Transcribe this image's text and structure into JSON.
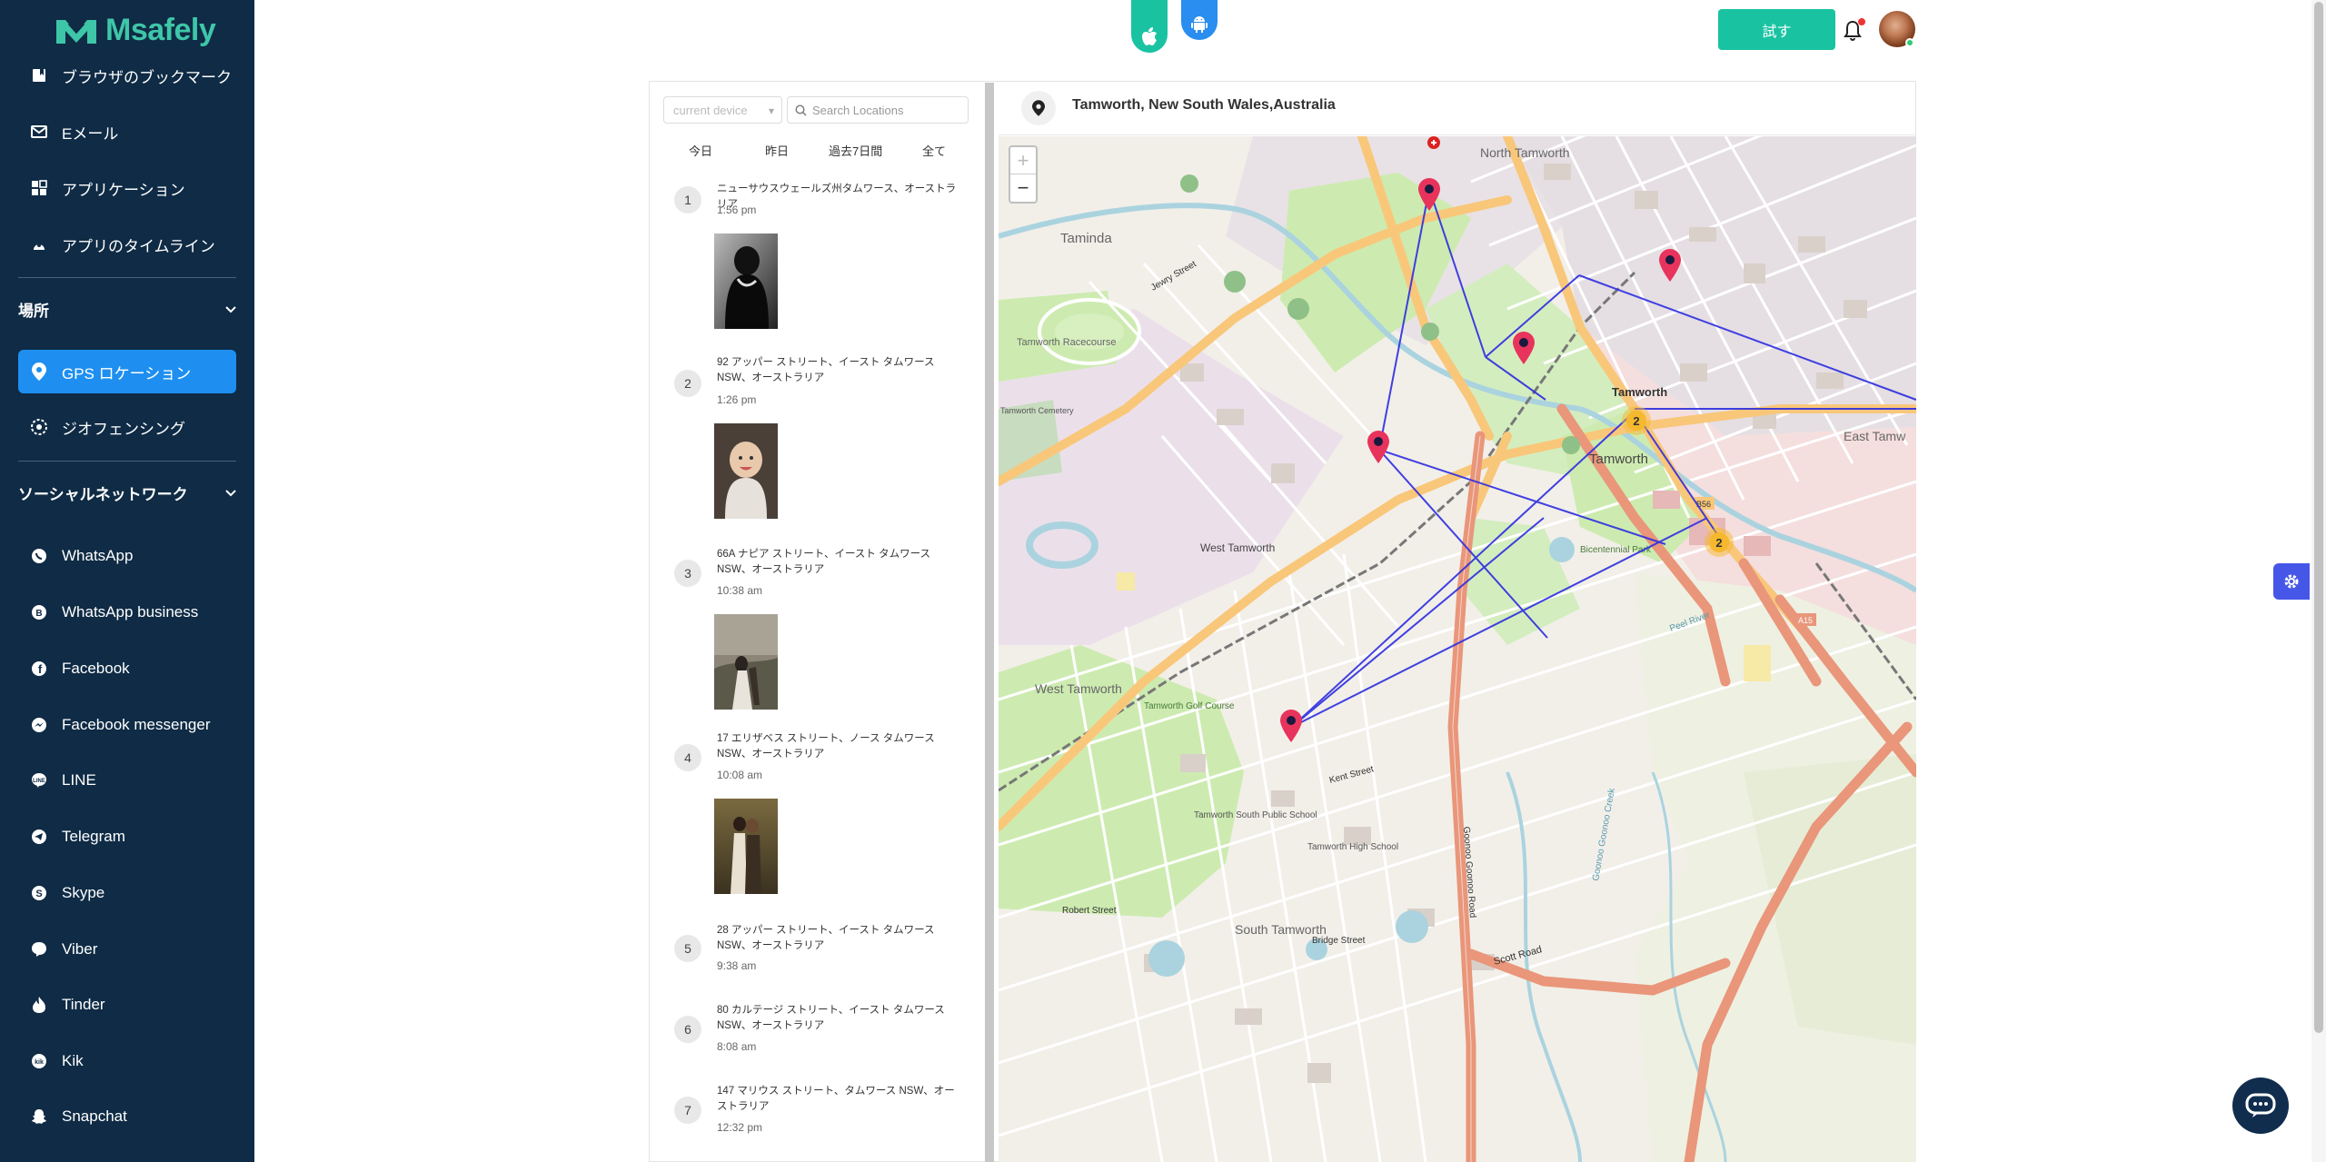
{
  "brand": {
    "name": "Msafely"
  },
  "sidebar": {
    "items_top": [
      {
        "label": "ブラウザのブックマーク",
        "icon": "bookmark-icon"
      },
      {
        "label": "Eメール",
        "icon": "mail-icon"
      },
      {
        "label": "アプリケーション",
        "icon": "apps-icon"
      },
      {
        "label": "アプリのタイムライン",
        "icon": "timeline-icon"
      }
    ],
    "section_location": "場所",
    "location_items": [
      {
        "label": "GPS ロケーション",
        "icon": "location-pin-icon",
        "active": true
      },
      {
        "label": "ジオフェンシング",
        "icon": "geofence-icon"
      }
    ],
    "section_social": "ソーシャルネットワーク",
    "social_items": [
      {
        "label": "WhatsApp",
        "icon": "whatsapp-icon"
      },
      {
        "label": "WhatsApp business",
        "icon": "whatsapp-business-icon"
      },
      {
        "label": "Facebook",
        "icon": "facebook-icon"
      },
      {
        "label": "Facebook messenger",
        "icon": "messenger-icon"
      },
      {
        "label": "LINE",
        "icon": "line-icon"
      },
      {
        "label": "Telegram",
        "icon": "telegram-icon"
      },
      {
        "label": "Skype",
        "icon": "skype-icon"
      },
      {
        "label": "Viber",
        "icon": "viber-icon"
      },
      {
        "label": "Tinder",
        "icon": "tinder-icon"
      },
      {
        "label": "Kik",
        "icon": "kik-icon"
      },
      {
        "label": "Snapchat",
        "icon": "snapchat-icon"
      }
    ]
  },
  "header": {
    "try_label": "試す"
  },
  "locations": {
    "device_placeholder": "current device",
    "search_placeholder": "Search Locations",
    "filters": [
      "今日",
      "昨日",
      "過去7日間",
      "全て"
    ],
    "entries": [
      {
        "num": "1",
        "address": "ニューサウスウェールズ州タムワース、オーストラリア",
        "time": "1:56 pm",
        "has_photo": true
      },
      {
        "num": "2",
        "address": "92 アッパー ストリート、イースト タムワース NSW、オーストラリア",
        "time": "1:26 pm",
        "has_photo": true
      },
      {
        "num": "3",
        "address": "66A ナピア ストリート、イースト タムワース NSW、オーストラリア",
        "time": "10:38 am",
        "has_photo": true
      },
      {
        "num": "4",
        "address": "17 エリザベス ストリート、ノース タムワース NSW、オーストラリア",
        "time": "10:08 am",
        "has_photo": true
      },
      {
        "num": "5",
        "address": "28 アッパー ストリート、イースト タムワース NSW、オーストラリア",
        "time": "9:38 am",
        "has_photo": false
      },
      {
        "num": "6",
        "address": "80 カルテージ ストリート、イースト タムワース NSW、オーストラリア",
        "time": "8:08 am",
        "has_photo": false
      },
      {
        "num": "7",
        "address": "147 マリウス ストリート、タムワース NSW、オーストラリア",
        "time": "12:32 pm",
        "has_photo": false
      }
    ]
  },
  "map": {
    "title": "Tamworth, New South Wales,Australia",
    "zoom_in": "+",
    "zoom_out": "−",
    "cluster_label": "2",
    "labels": {
      "taminda": "Taminda",
      "north_tamworth": "North Tamworth",
      "tamworth": "Tamworth",
      "west_tamworth": "West Tamworth",
      "east_tamworth": "East Tamw",
      "south_tamworth": "South Tamworth",
      "racecourse": "Tamworth Racecourse",
      "golf": "Tamworth Golf Course",
      "south_school": "Tamworth South Public School",
      "high_school": "Tamworth High School",
      "cemetery": "Tamworth Cemetery",
      "bicentennial": "Bicentennial Park",
      "peel_river": "Peel River",
      "goonoo_creek": "Goonoo Goonoo Creek",
      "scott_road": "Scott Road",
      "goonoo_road": "Goonoo Goonoo Road",
      "jewry": "Jewry Street",
      "kent": "Kent Street",
      "robert": "Robert Street",
      "bridge": "Bridge Street",
      "a15": "A15",
      "b56": "B56"
    },
    "colors": {
      "route": "#2d2de0",
      "pin": "#e8335c",
      "cluster": "#f5b82e",
      "main_road": "#e9967a",
      "secondary_road": "#f9c77a",
      "park": "#cdebb0"
    }
  }
}
